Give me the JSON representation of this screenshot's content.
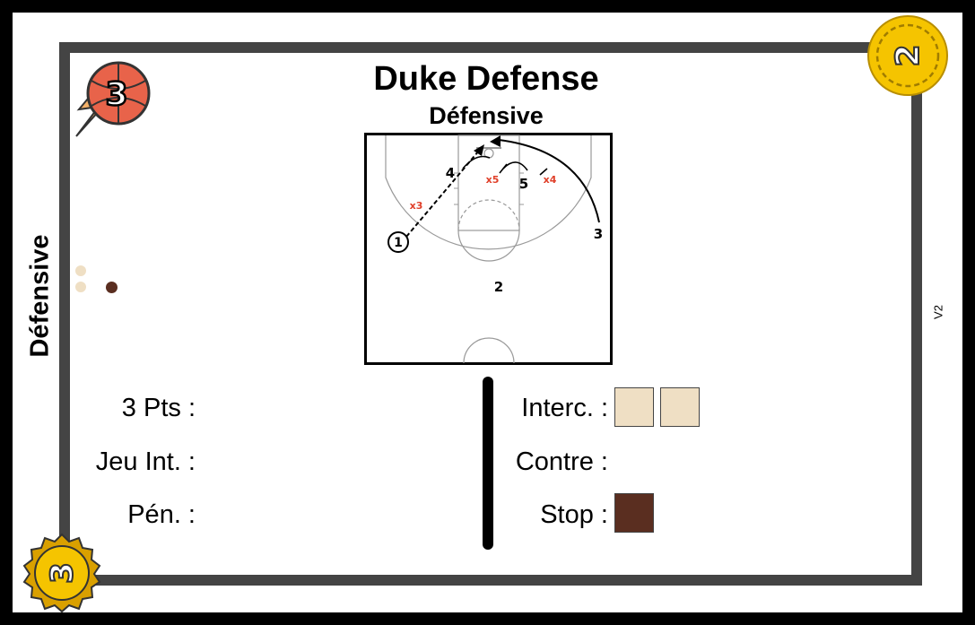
{
  "card": {
    "title": "Duke Defense",
    "subtitle": "Défensive",
    "side_label": "Défensive",
    "version": "V2",
    "top_left_badge": {
      "icon": "basketball-flame-icon",
      "value": "3",
      "color": "#e8634a"
    },
    "top_right_badge": {
      "icon": "gold-coin-icon",
      "value": "2",
      "color": "#f5c400"
    },
    "bottom_left_badge": {
      "icon": "gold-medal-icon",
      "value": "3",
      "color": "#f0b400"
    }
  },
  "play_diagram": {
    "players": [
      "1",
      "2",
      "3",
      "4",
      "5"
    ],
    "defenders": [
      "x3",
      "x4",
      "x5"
    ]
  },
  "stats_left": [
    {
      "label": "3 Pts :"
    },
    {
      "label": "Jeu Int. :"
    },
    {
      "label": "Pén. :"
    }
  ],
  "stats_right": [
    {
      "label": "Interc. :",
      "boxes": 2,
      "color": "#efdfc4"
    },
    {
      "label": "Contre :",
      "boxes": 0
    },
    {
      "label": "Stop :",
      "boxes": 1,
      "color": "#5a2e20"
    }
  ],
  "dots": [
    {
      "color": "#efdfc4"
    },
    {
      "color": "#efdfc4"
    },
    {
      "color": "#5a2e20"
    }
  ]
}
